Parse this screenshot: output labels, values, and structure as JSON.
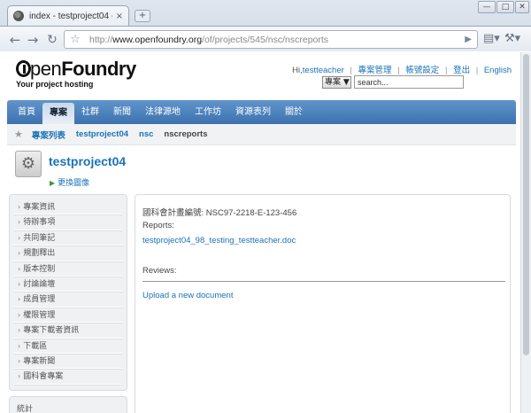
{
  "browser": {
    "tab_title": "index - testproject04 - O···",
    "tab_close": "×",
    "new_tab": "+",
    "url_prefix": "http://",
    "url_domain": "www.openfoundry.org",
    "url_path": "/of/projects/545/nsc/nscreports",
    "window_controls": [
      "—",
      "□",
      "✕"
    ],
    "icons": {
      "back": "arrow-left-icon",
      "forward": "arrow-right-icon",
      "reload": "reload-icon",
      "bookmark": "star-icon",
      "go": "play-icon",
      "page_menu": "page-icon",
      "tools": "wrench-icon"
    }
  },
  "header": {
    "logo_text_open": "pen",
    "logo_text_foundry": "Foundry",
    "tagline": "Your project hosting",
    "greeting": "Hi,",
    "username": "testteacher",
    "links": [
      "專案管理",
      "帳號設定",
      "登出",
      "English"
    ],
    "search_scope": "專案 ▼",
    "search_value": "search..."
  },
  "nav": {
    "items": [
      "首頁",
      "專案",
      "社群",
      "新聞",
      "法律源地",
      "工作坊",
      "資源表列",
      "關於"
    ],
    "active_index": 1
  },
  "breadcrumb": {
    "links": [
      "專案列表",
      "testproject04",
      "nsc"
    ],
    "current": "nscreports"
  },
  "project": {
    "title": "testproject04",
    "change_image": "更換圖像"
  },
  "sidebar": {
    "items": [
      "專案資訊",
      "待辦事項",
      "共同筆記",
      "規劃釋出",
      "版本控制",
      "討論論壇",
      "成員管理",
      "權限管理",
      "專案下載者資訊",
      "下載區",
      "專案新聞",
      "國科會專案"
    ],
    "bottom_label": "統計"
  },
  "main": {
    "grant_label": "國科會計畫編號:",
    "grant_value": "NSC97-2218-E-123-456",
    "reports_label": "Reports:",
    "report_file": "testproject04_98_testing_testteacher.doc",
    "reviews_label": "Reviews:",
    "upload_link": "Upload a new document"
  }
}
